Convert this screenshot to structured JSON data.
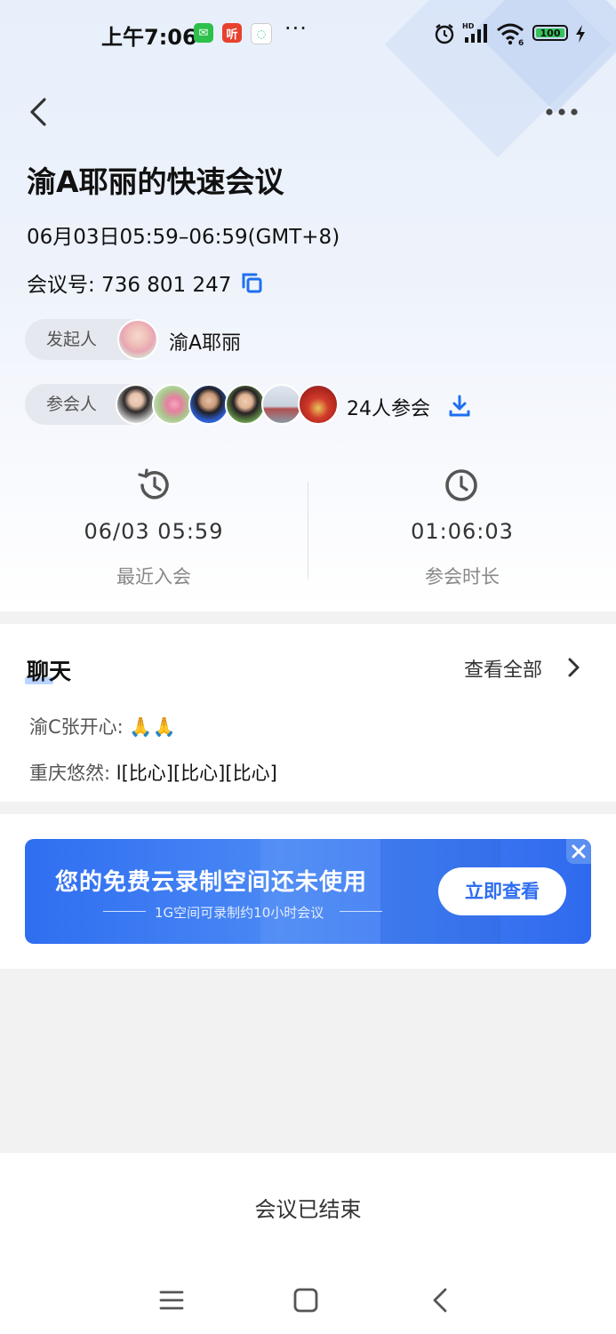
{
  "status_bar": {
    "time": "上午7:06",
    "app_icons": [
      "wechat-icon",
      "ting-icon",
      "chat-bubble-icon"
    ],
    "more": "···",
    "battery": "100",
    "colors": {
      "wechat": "#2dc14b",
      "ting": "#e8412d",
      "battery_fill": "#35c35a"
    }
  },
  "meeting": {
    "title": "渝A耶丽的快速会议",
    "time_range": "06月03日05:59–06:59(GMT+8)",
    "meeting_id": "会议号: 736 801 247"
  },
  "host": {
    "label": "发起人",
    "name": "渝A耶丽"
  },
  "attendees": {
    "label": "参会人",
    "count_text": "24人参会"
  },
  "stats": {
    "recent_join_value": "06/03 05:59",
    "recent_join_label": "最近入会",
    "duration_value": "01:06:03",
    "duration_label": "参会时长"
  },
  "chat": {
    "title": "聊天",
    "view_all": "查看全部",
    "messages": [
      {
        "sender": "渝C张开心: ",
        "text": "🙏🙏"
      },
      {
        "sender": "重庆悠然: ",
        "text": "l[比心][比心][比心]"
      }
    ]
  },
  "banner": {
    "title": "您的免费云录制空间还未使用",
    "subtitle": "1G空间可录制约10小时会议",
    "button": "立即查看",
    "accent": "#2f6ef0"
  },
  "footer": {
    "status": "会议已结束"
  }
}
